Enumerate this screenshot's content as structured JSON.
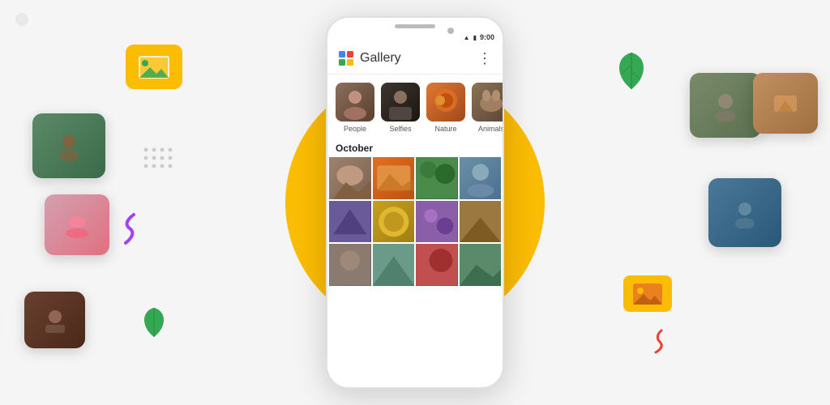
{
  "app": {
    "title": "Gallery",
    "status_bar": {
      "signal": "▲▼",
      "battery": "🔋",
      "time": "9:00"
    },
    "more_icon": "⋮"
  },
  "categories": [
    {
      "id": "people",
      "label": "People",
      "color": "#8B6F5E"
    },
    {
      "id": "selfies",
      "label": "Selfies",
      "color": "#3D3530"
    },
    {
      "id": "nature",
      "label": "Nature",
      "color": "#E07830"
    },
    {
      "id": "animals",
      "label": "Animals",
      "color": "#8B7355"
    }
  ],
  "sections": [
    {
      "title": "October",
      "photos": [
        {
          "color": "#A0826D"
        },
        {
          "color": "#E07020"
        },
        {
          "color": "#3A7D3C"
        },
        {
          "color": "#6A90A8"
        },
        {
          "color": "#5E4A8E"
        },
        {
          "color": "#C8A020"
        },
        {
          "color": "#7B4EA0"
        },
        {
          "color": "#8B6A30"
        },
        {
          "color": "#7A6E65"
        },
        {
          "color": "#5A8A78"
        },
        {
          "color": "#B04040"
        },
        {
          "color": "#4A7A5A"
        }
      ]
    }
  ],
  "floating_photos": [
    {
      "id": "fp1",
      "color": "#5B8A68",
      "class": "fp-1"
    },
    {
      "id": "fp2",
      "color": "#D4607A",
      "class": "fp-2"
    },
    {
      "id": "fp3",
      "color": "#8B5E3C",
      "class": "fp-3"
    },
    {
      "id": "fp4",
      "color": "#6A7A5A",
      "class": "fp-4"
    },
    {
      "id": "fp5",
      "color": "#4A7898",
      "class": "fp-5"
    },
    {
      "id": "fp6",
      "color": "#C07840",
      "class": "fp-6"
    }
  ],
  "decorations": {
    "leaf_color": "#34A853",
    "s_curve_color_1": "#A142F4",
    "s_curve_color_2": "#EA4335",
    "card_icon_bg": "#FBBC04"
  },
  "logo": {
    "colors": {
      "blue": "#4285F4",
      "red": "#EA4335",
      "yellow": "#FBBC04",
      "green": "#34A853"
    }
  }
}
